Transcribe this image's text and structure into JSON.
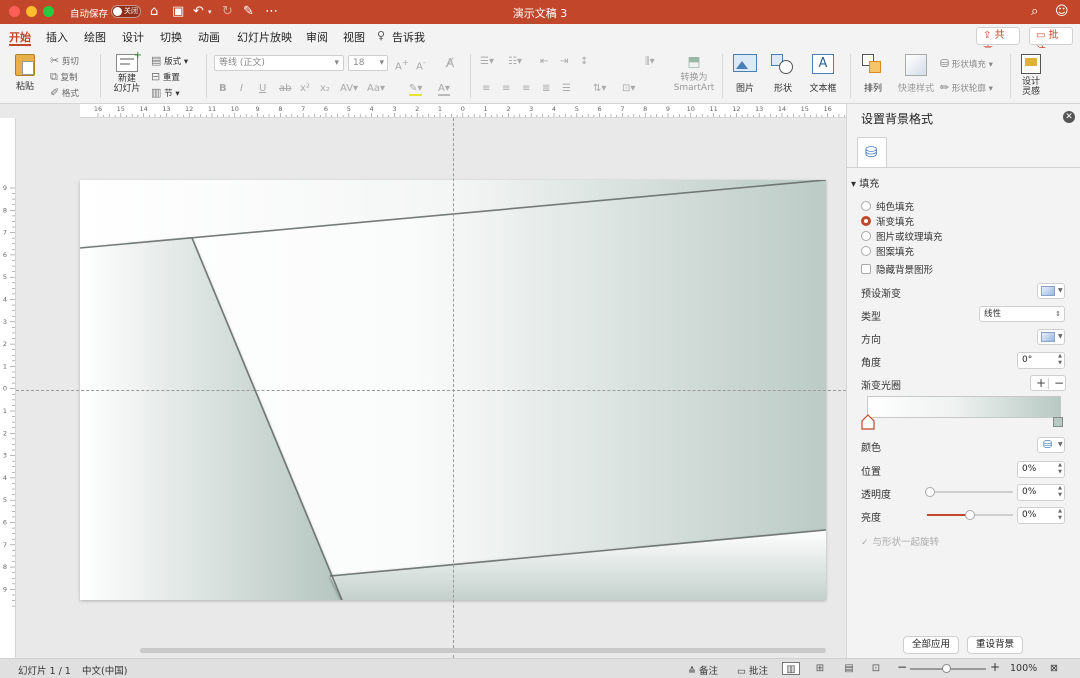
{
  "titlebar": {
    "autosave_label": "自动保存",
    "autosave_state": "关闭",
    "doc_title": "演示文稿 3"
  },
  "tabs": [
    "开始",
    "插入",
    "绘图",
    "设计",
    "切换",
    "动画",
    "幻灯片放映",
    "审阅",
    "视图",
    "告诉我"
  ],
  "actions": {
    "share": "共享",
    "comment": "批注"
  },
  "ribbon": {
    "paste": "粘贴",
    "cut": "剪切",
    "copy": "复制",
    "format": "格式",
    "new_slide_line1": "新建",
    "new_slide_line2": "幻灯片",
    "layout": "版式",
    "reset": "重置",
    "section": "节",
    "font_name": "等线 (正文)",
    "font_size": "18",
    "convert_smartart_line1": "转换为",
    "convert_smartart_line2": "SmartArt",
    "picture": "图片",
    "shape": "形状",
    "textbox": "文本框",
    "arrange": "排列",
    "quick_styles": "快速样式",
    "shape_fill": "形状填充",
    "shape_outline": "形状轮廓",
    "designer_line1": "设计",
    "designer_line2": "灵感"
  },
  "ruler": {
    "h_labels": [
      "16",
      "15",
      "14",
      "13",
      "12",
      "11",
      "10",
      "9",
      "8",
      "7",
      "6",
      "5",
      "4",
      "3",
      "2",
      "1",
      "0",
      "1",
      "2",
      "3",
      "4",
      "5",
      "6",
      "7",
      "8",
      "9",
      "10",
      "11",
      "12",
      "13",
      "14",
      "15",
      "16"
    ],
    "v_labels": [
      "9",
      "8",
      "7",
      "6",
      "5",
      "4",
      "3",
      "2",
      "1",
      "0",
      "1",
      "2",
      "3",
      "4",
      "5",
      "6",
      "7",
      "8",
      "9"
    ]
  },
  "pane": {
    "title": "设置背景格式",
    "section_fill": "填充",
    "fill_options": [
      "纯色填充",
      "渐变填充",
      "图片或纹理填充",
      "图案填充"
    ],
    "selected_fill": "渐变填充",
    "hide_bg_graphics": "隐藏背景图形",
    "preset_gradient": "预设渐变",
    "type_label": "类型",
    "type_value": "线性",
    "direction_label": "方向",
    "angle_label": "角度",
    "angle_value": "0°",
    "gradient_stops": "渐变光圈",
    "color_label": "颜色",
    "position_label": "位置",
    "position_value": "0%",
    "transparency_label": "透明度",
    "transparency_value": "0%",
    "brightness_label": "亮度",
    "brightness_value": "0%",
    "rotate_with_shape": "与形状一起旋转",
    "apply_all": "全部应用",
    "reset_bg": "重设背景"
  },
  "status": {
    "slide_info": "幻灯片 1 / 1",
    "language": "中文(中国)",
    "notes": "备注",
    "comments": "批注",
    "zoom": "100%"
  },
  "colors": {
    "accent": "#c2462a",
    "slide_gradient_end": "#b8c9c3"
  }
}
